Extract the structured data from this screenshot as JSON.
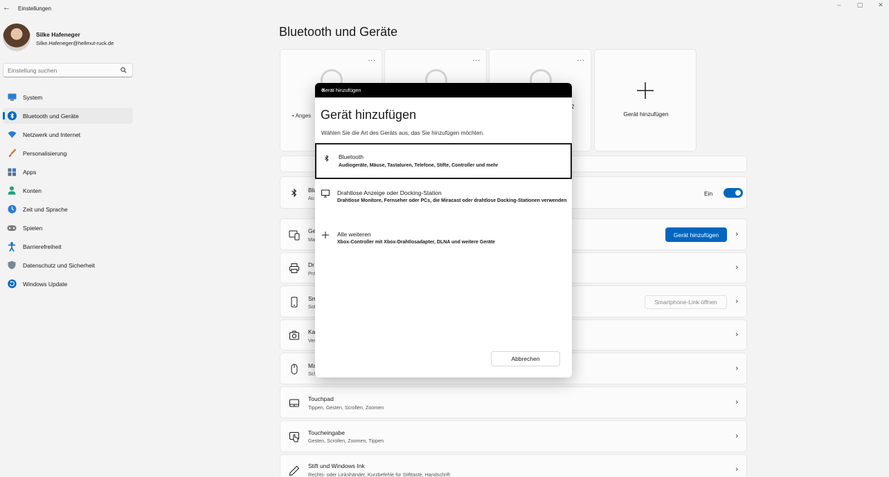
{
  "window": {
    "title": "Einstellungen",
    "controls": [
      "–",
      "▢",
      "✕"
    ]
  },
  "user": {
    "name": "Silke Hafeneger",
    "email": "Silke.Hafeneger@hellmut-ruck.de"
  },
  "search": {
    "placeholder": "Einstellung suchen"
  },
  "sidebar": {
    "items": [
      {
        "label": "System",
        "icon": "monitor-icon",
        "active": false
      },
      {
        "label": "Bluetooth und Geräte",
        "icon": "bluetooth-icon",
        "active": true
      },
      {
        "label": "Netzwerk und Internet",
        "icon": "wifi-icon",
        "active": false
      },
      {
        "label": "Personalisierung",
        "icon": "brush-icon",
        "active": false
      },
      {
        "label": "Apps",
        "icon": "apps-icon",
        "active": false
      },
      {
        "label": "Konten",
        "icon": "person-icon",
        "active": false
      },
      {
        "label": "Zeit und Sprache",
        "icon": "globe-clock-icon",
        "active": false
      },
      {
        "label": "Spielen",
        "icon": "gamepad-icon",
        "active": false
      },
      {
        "label": "Barrierefreiheit",
        "icon": "accessibility-icon",
        "active": false
      },
      {
        "label": "Datenschutz und Sicherheit",
        "icon": "shield-icon",
        "active": false
      },
      {
        "label": "Windows Update",
        "icon": "update-icon",
        "active": false
      }
    ]
  },
  "main": {
    "title": "Bluetooth und Geräte",
    "device_cards": [
      {
        "status": "• Anges",
        "menu": "..."
      },
      {
        "status": "",
        "menu": "..."
      },
      {
        "status": "2",
        "menu": "..."
      }
    ],
    "add_card": {
      "label": "Gerät hinzufügen"
    },
    "rows": [
      {
        "title": "Blu",
        "sub": "Au",
        "toggle_label": "Ein",
        "toggle_on": true
      },
      {
        "title": "Ge",
        "sub": "Ma",
        "button": "Gerät hinzufügen"
      },
      {
        "title": "Dr",
        "sub": "Prä"
      },
      {
        "title": "Sm",
        "sub": "Sof",
        "button": "Smartphone-Link öffnen"
      },
      {
        "title": "Ka",
        "sub": "Ver"
      },
      {
        "title": "Ma",
        "sub": "Sch"
      },
      {
        "title": "Touchpad",
        "sub": "Tippen, Gesten, Scrollen, Zoomen"
      },
      {
        "title": "Toucheingabe",
        "sub": "Gesten, Scrollen, Zoomen, Tippen"
      },
      {
        "title": "Stift und Windows Ink",
        "sub": "Rechts- oder Linkshänder, Kurzbefehle für Stifttaste, Handschrift"
      }
    ]
  },
  "dialog": {
    "window_title": "Gerät hinzufügen",
    "heading": "Gerät hinzufügen",
    "description": "Wählen Sie die Art des Geräts aus, das Sie hinzufügen möchten.",
    "options": [
      {
        "title": "Bluetooth",
        "sub": "Audiogeräte, Mäuse, Tastaturen, Telefone, Stifte, Controller und mehr",
        "selected": true
      },
      {
        "title": "Drahtlose Anzeige oder Docking-Station",
        "sub": "Drahtlose Monitore, Fernseher oder PCs, die Miracast oder drahtlose Docking-Stationen verwenden",
        "selected": false
      },
      {
        "title": "Alle weiteren",
        "sub": "Xbox-Controller mit Xbox-Drahtlosadapter, DLNA und weitere Geräte",
        "selected": false
      }
    ],
    "cancel": "Abbrechen"
  },
  "colors": {
    "accent": "#0067c0",
    "background": "#f3f3f3",
    "card": "#fbfbfb",
    "dialog_titlebar": "#000000"
  }
}
